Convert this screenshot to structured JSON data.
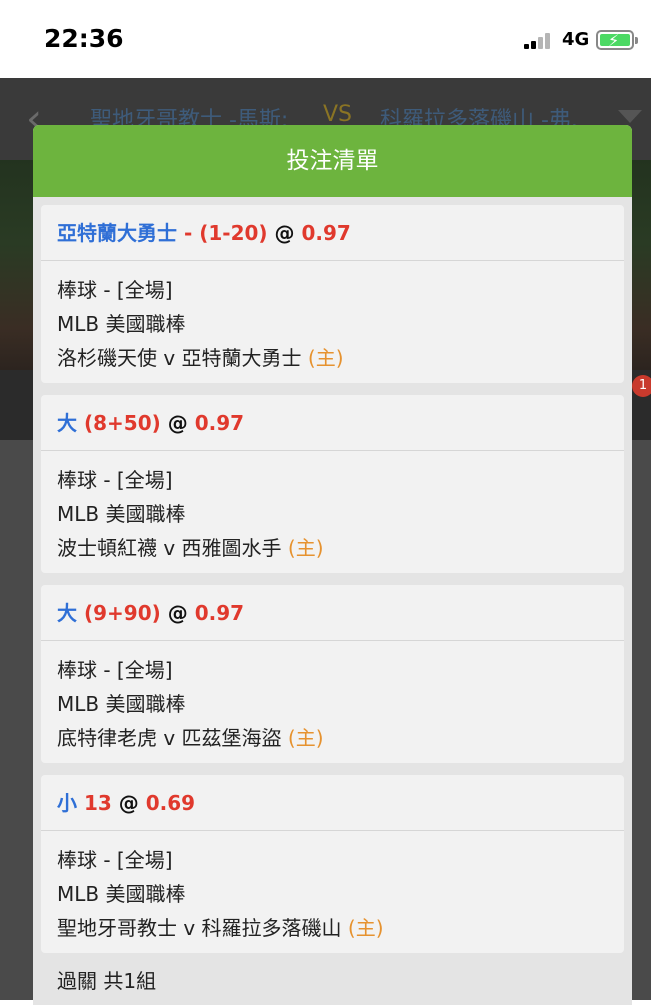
{
  "status_bar": {
    "time": "22:36",
    "network": "4G",
    "battery_charging": true
  },
  "background": {
    "home_team": "聖地牙哥教士 -馬斯:",
    "vs": "VS",
    "away_team": "科羅拉多落磯山 -弗.",
    "badge_count": "1"
  },
  "modal": {
    "title": "投注清單",
    "bets": [
      {
        "selection": "亞特蘭大勇士",
        "line": " - (1-20)",
        "at": " @ ",
        "odds": "0.97",
        "sport_period": "棒球 - [全場]",
        "league": "MLB 美國職棒",
        "match": "洛杉磯天使 v 亞特蘭大勇士 ",
        "home_tag": "(主)"
      },
      {
        "selection": "大",
        "line": " (8+50)",
        "at": " @ ",
        "odds": "0.97",
        "sport_period": "棒球 - [全場]",
        "league": "MLB 美國職棒",
        "match": "波士頓紅襪 v 西雅圖水手 ",
        "home_tag": "(主)"
      },
      {
        "selection": "大",
        "line": " (9+90)",
        "at": " @ ",
        "odds": "0.97",
        "sport_period": "棒球 - [全場]",
        "league": "MLB 美國職棒",
        "match": "底特律老虎 v 匹茲堡海盜 ",
        "home_tag": "(主)"
      },
      {
        "selection": "小",
        "line": " 13",
        "at": " @ ",
        "odds": "0.69",
        "sport_period": "棒球 - [全場]",
        "league": "MLB 美國職棒",
        "match": "聖地牙哥教士 v 科羅拉多落磯山 ",
        "home_tag": "(主)"
      }
    ],
    "parlay_label": "過關 共1組"
  },
  "colors": {
    "header_green": "#6db43e",
    "selection_blue": "#2f6fd6",
    "odds_red": "#e0392d",
    "home_orange": "#e6922f"
  }
}
